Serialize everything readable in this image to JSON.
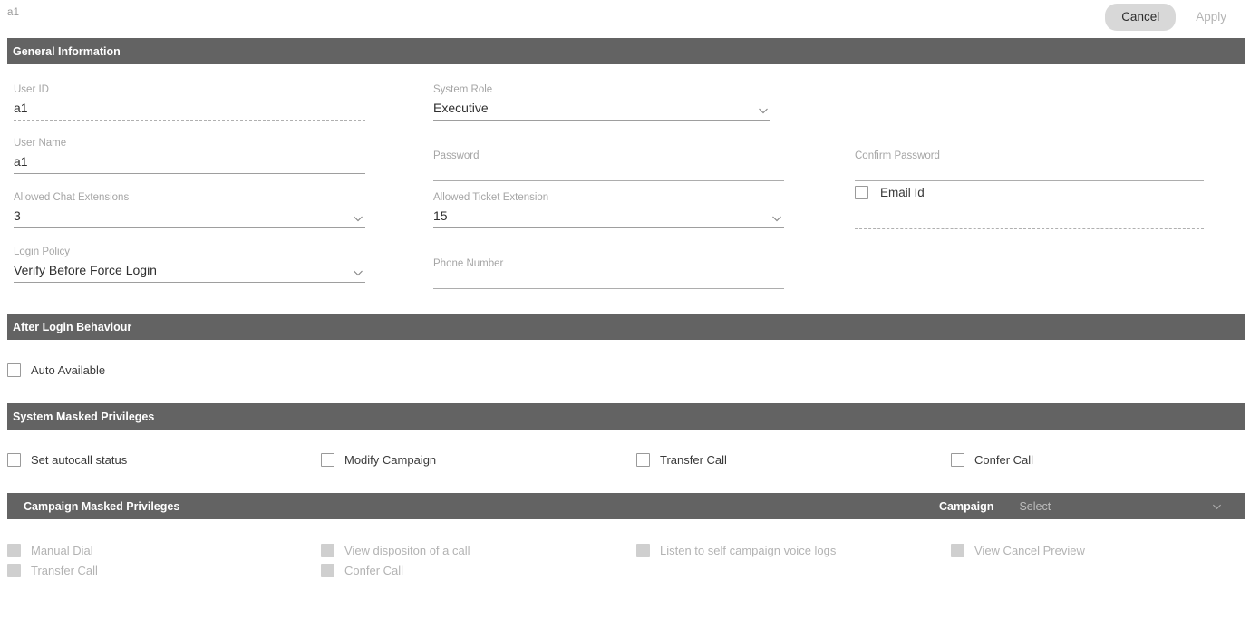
{
  "topbar": {
    "title": "a1",
    "cancel_label": "Cancel",
    "apply_label": "Apply"
  },
  "sections": {
    "general": {
      "title": "General Information"
    },
    "after_login": {
      "title": "After Login Behaviour"
    },
    "system_masked": {
      "title": "System Masked Privileges"
    },
    "campaign_masked": {
      "title": "Campaign Masked Privileges",
      "campaign_label": "Campaign",
      "campaign_value": "Select"
    }
  },
  "general_fields": {
    "user_id": {
      "label": "User ID",
      "value": "a1"
    },
    "user_name": {
      "label": "User Name",
      "value": "a1"
    },
    "chat_ext": {
      "label": "Allowed Chat Extensions",
      "value": "3"
    },
    "login_policy": {
      "label": "Login Policy",
      "value": "Verify Before Force Login"
    },
    "system_role": {
      "label": "System Role",
      "value": "Executive"
    },
    "password": {
      "label": "Password",
      "value": ""
    },
    "ticket_ext": {
      "label": "Allowed Ticket Extension",
      "value": "15"
    },
    "phone_number": {
      "label": "Phone Number",
      "value": ""
    },
    "confirm_password": {
      "label": "Confirm Password",
      "value": ""
    },
    "email_id": {
      "label": "Email Id",
      "value": ""
    }
  },
  "after_login_options": [
    {
      "label": "Auto Available",
      "checked": false
    }
  ],
  "system_masked_options": [
    {
      "label": "Set autocall status",
      "checked": false
    },
    {
      "label": "Modify Campaign",
      "checked": false
    },
    {
      "label": "Transfer Call",
      "checked": false
    },
    {
      "label": "Confer Call",
      "checked": false
    }
  ],
  "campaign_masked_options": [
    {
      "label": "Manual Dial",
      "checked": false,
      "disabled": true
    },
    {
      "label": "Transfer Call",
      "checked": false,
      "disabled": true
    },
    {
      "label": "View dispositon of a call",
      "checked": false,
      "disabled": true
    },
    {
      "label": "Confer Call",
      "checked": false,
      "disabled": true
    },
    {
      "label": "Listen to self campaign voice logs",
      "checked": false,
      "disabled": true
    },
    {
      "label": "View Cancel Preview",
      "checked": false,
      "disabled": true
    }
  ],
  "colors": {
    "section_bar": "#636363",
    "cancel_button": "#d8d8d8",
    "label_text": "#a5a5a5",
    "value_text": "#2f2f2f",
    "disabled_text": "#b3b3b3"
  }
}
